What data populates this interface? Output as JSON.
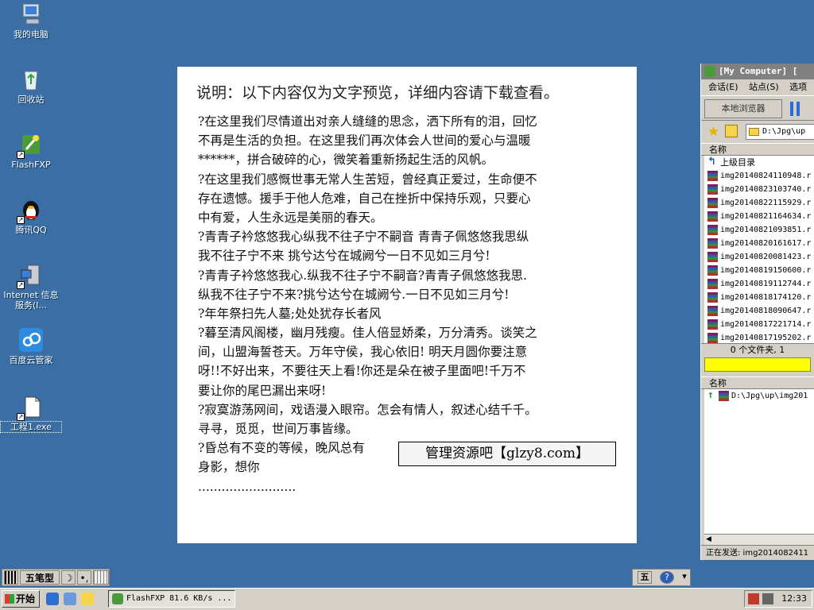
{
  "desktop": {
    "icons": [
      {
        "label": "我的电脑"
      },
      {
        "label": "回收站"
      },
      {
        "label": "FlashFXP"
      },
      {
        "label": "腾讯QQ"
      },
      {
        "label": "Internet 信息服务(I..."
      },
      {
        "label": "百度云管家"
      },
      {
        "label": "工程1.exe"
      }
    ]
  },
  "document": {
    "title": "说明：以下内容仅为文字预览，详细内容请下载查看。",
    "lines": [
      "?在这里我们尽情道出对亲人缝缝的思念，洒下所有的泪，回忆",
      "不再是生活的负担。在这里我们再次体会人世间的爱心与温暖",
      "******，拼合破碎的心，微笑着重新扬起生活的风帆。",
      "?在这里我们感慨世事无常人生苦短，曾经真正爱过，生命便不",
      "存在遗憾。援手于他人危难，自己在挫折中保持乐观，只要心",
      "中有爱，人生永远是美丽的春天。",
      "?青青子衿悠悠我心纵我不往子宁不嗣音 青青子佩悠悠我思纵",
      "我不往子宁不来 挑兮达兮在城阙兮一日不见如三月兮!",
      "?青青子衿悠悠我心.纵我不往子宁不嗣音?青青子佩悠悠我思.",
      "纵我不往子宁不来?挑兮达兮在城阙兮.一日不见如三月兮!",
      "?年年祭扫先人墓;处处犹存长者风",
      "?暮至清风阁楼，幽月残瘦。佳人倍显娇柔，万分清秀。谈笑之",
      "间，山盟海誓苍天。万年守侯，我心依旧! 明天月圆你要注意",
      "呀!!不好出来，不要往天上看!你还是朵在被子里面吧!千万不",
      "要让你的尾巴漏出来呀!",
      "?寂寞游荡网间，戏语漫入眼帘。怎会有情人，叙述心结千千。",
      "寻寻，觅觅，世间万事皆缘。",
      "?昏总有不变的等候，晚风总有",
      "身影，想你",
      "........................."
    ],
    "watermark": "管理资源吧【glzy8.com】"
  },
  "flashfxp": {
    "title": "[My Computer]  [",
    "menu": [
      "会话(E)",
      "站点(S)",
      "选项"
    ],
    "local_browser_label": "本地浏览器",
    "path": "D:\\Jpg\\up",
    "column_name": "名称",
    "up_dir_label": "上级目录",
    "files": [
      "img20140824110948.r",
      "img20140823103740.r",
      "img20140822115929.r",
      "img20140821164634.r",
      "img20140821093851.r",
      "img20140820161617.r",
      "img20140820081423.r",
      "img20140819150600.r",
      "img20140819112744.r",
      "img20140818174120.r",
      "img20140818090647.r",
      "img20140817221714.r",
      "img20140817195202.r"
    ],
    "file_count_status": "0 个文件夹, 1",
    "queue_column_name": "名称",
    "queue_item": "D:\\Jpg\\up\\img201",
    "sending_status": "正在发送: img2014082411"
  },
  "ime": {
    "mode_label": "五笔型",
    "moon_glyph": "☽",
    "punct_glyph": "•,"
  },
  "tray2": {
    "ime_glyph": "五",
    "help_glyph": "?"
  },
  "taskbar": {
    "start_label": "开始",
    "task_label": "FlashFXP 81.6 KB/s ...",
    "clock": "12:33"
  },
  "colors": {
    "desktop_bg": "#3a6ea5",
    "progress_yellow": "#ffff00"
  }
}
